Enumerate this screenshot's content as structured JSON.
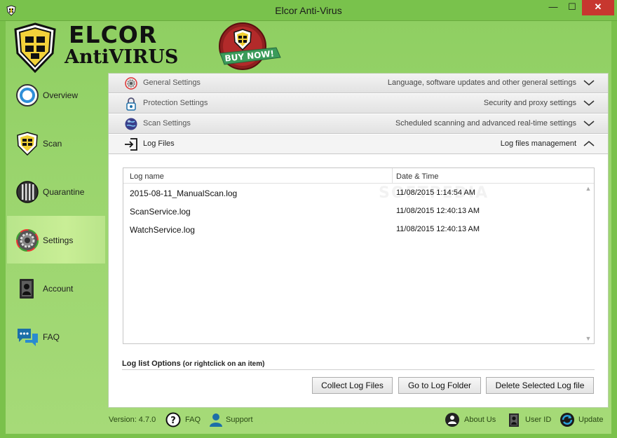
{
  "window": {
    "title": "Elcor Anti-Virus",
    "minimize": "—",
    "maximize": "☐",
    "close": "✕"
  },
  "brand": {
    "line1": "ELCOR",
    "line2": "AntiVIRUS",
    "buy_now": "BUY NOW!"
  },
  "sidebar": {
    "items": [
      {
        "label": "Overview",
        "icon": "overview-icon",
        "active": false
      },
      {
        "label": "Scan",
        "icon": "scan-shield-icon",
        "active": false
      },
      {
        "label": "Quarantine",
        "icon": "quarantine-icon",
        "active": false
      },
      {
        "label": "Settings",
        "icon": "gear-icon",
        "active": true
      },
      {
        "label": "Account",
        "icon": "account-icon",
        "active": false
      },
      {
        "label": "FAQ",
        "icon": "chat-bubbles-icon",
        "active": false
      }
    ]
  },
  "settings": {
    "sections": [
      {
        "title": "General Settings",
        "description": "Language, software updates and other general settings",
        "expanded": false
      },
      {
        "title": "Protection Settings",
        "description": "Security and proxy settings",
        "expanded": false
      },
      {
        "title": "Scan Settings",
        "description": "Scheduled scanning and advanced real-time settings",
        "expanded": false
      },
      {
        "title": "Log Files",
        "description": "Log files management",
        "expanded": true
      }
    ]
  },
  "logs": {
    "columns": [
      "Log name",
      "Date & Time"
    ],
    "rows": [
      {
        "name": "2015-08-11_ManualScan.log",
        "datetime": "11/08/2015 1:14:54 AM"
      },
      {
        "name": "ScanService.log",
        "datetime": "11/08/2015 12:40:13 AM"
      },
      {
        "name": "WatchService.log",
        "datetime": "11/08/2015 12:40:13 AM"
      }
    ],
    "options_title": "Log list Options",
    "options_hint": "(or rightclick on an item)",
    "buttons": {
      "collect": "Collect Log Files",
      "goto": "Go to Log Folder",
      "delete": "Delete Selected Log file"
    }
  },
  "footer": {
    "version": "Version: 4.7.0",
    "faq": "FAQ",
    "support": "Support",
    "about": "About Us",
    "user_id": "User ID",
    "update": "Update"
  },
  "watermark": "SOFTPEDIA",
  "colors": {
    "frame": "#8fcf62",
    "titlebar": "#79c24c",
    "active_nav": "#c9ee96",
    "close_button": "#c7372f"
  }
}
